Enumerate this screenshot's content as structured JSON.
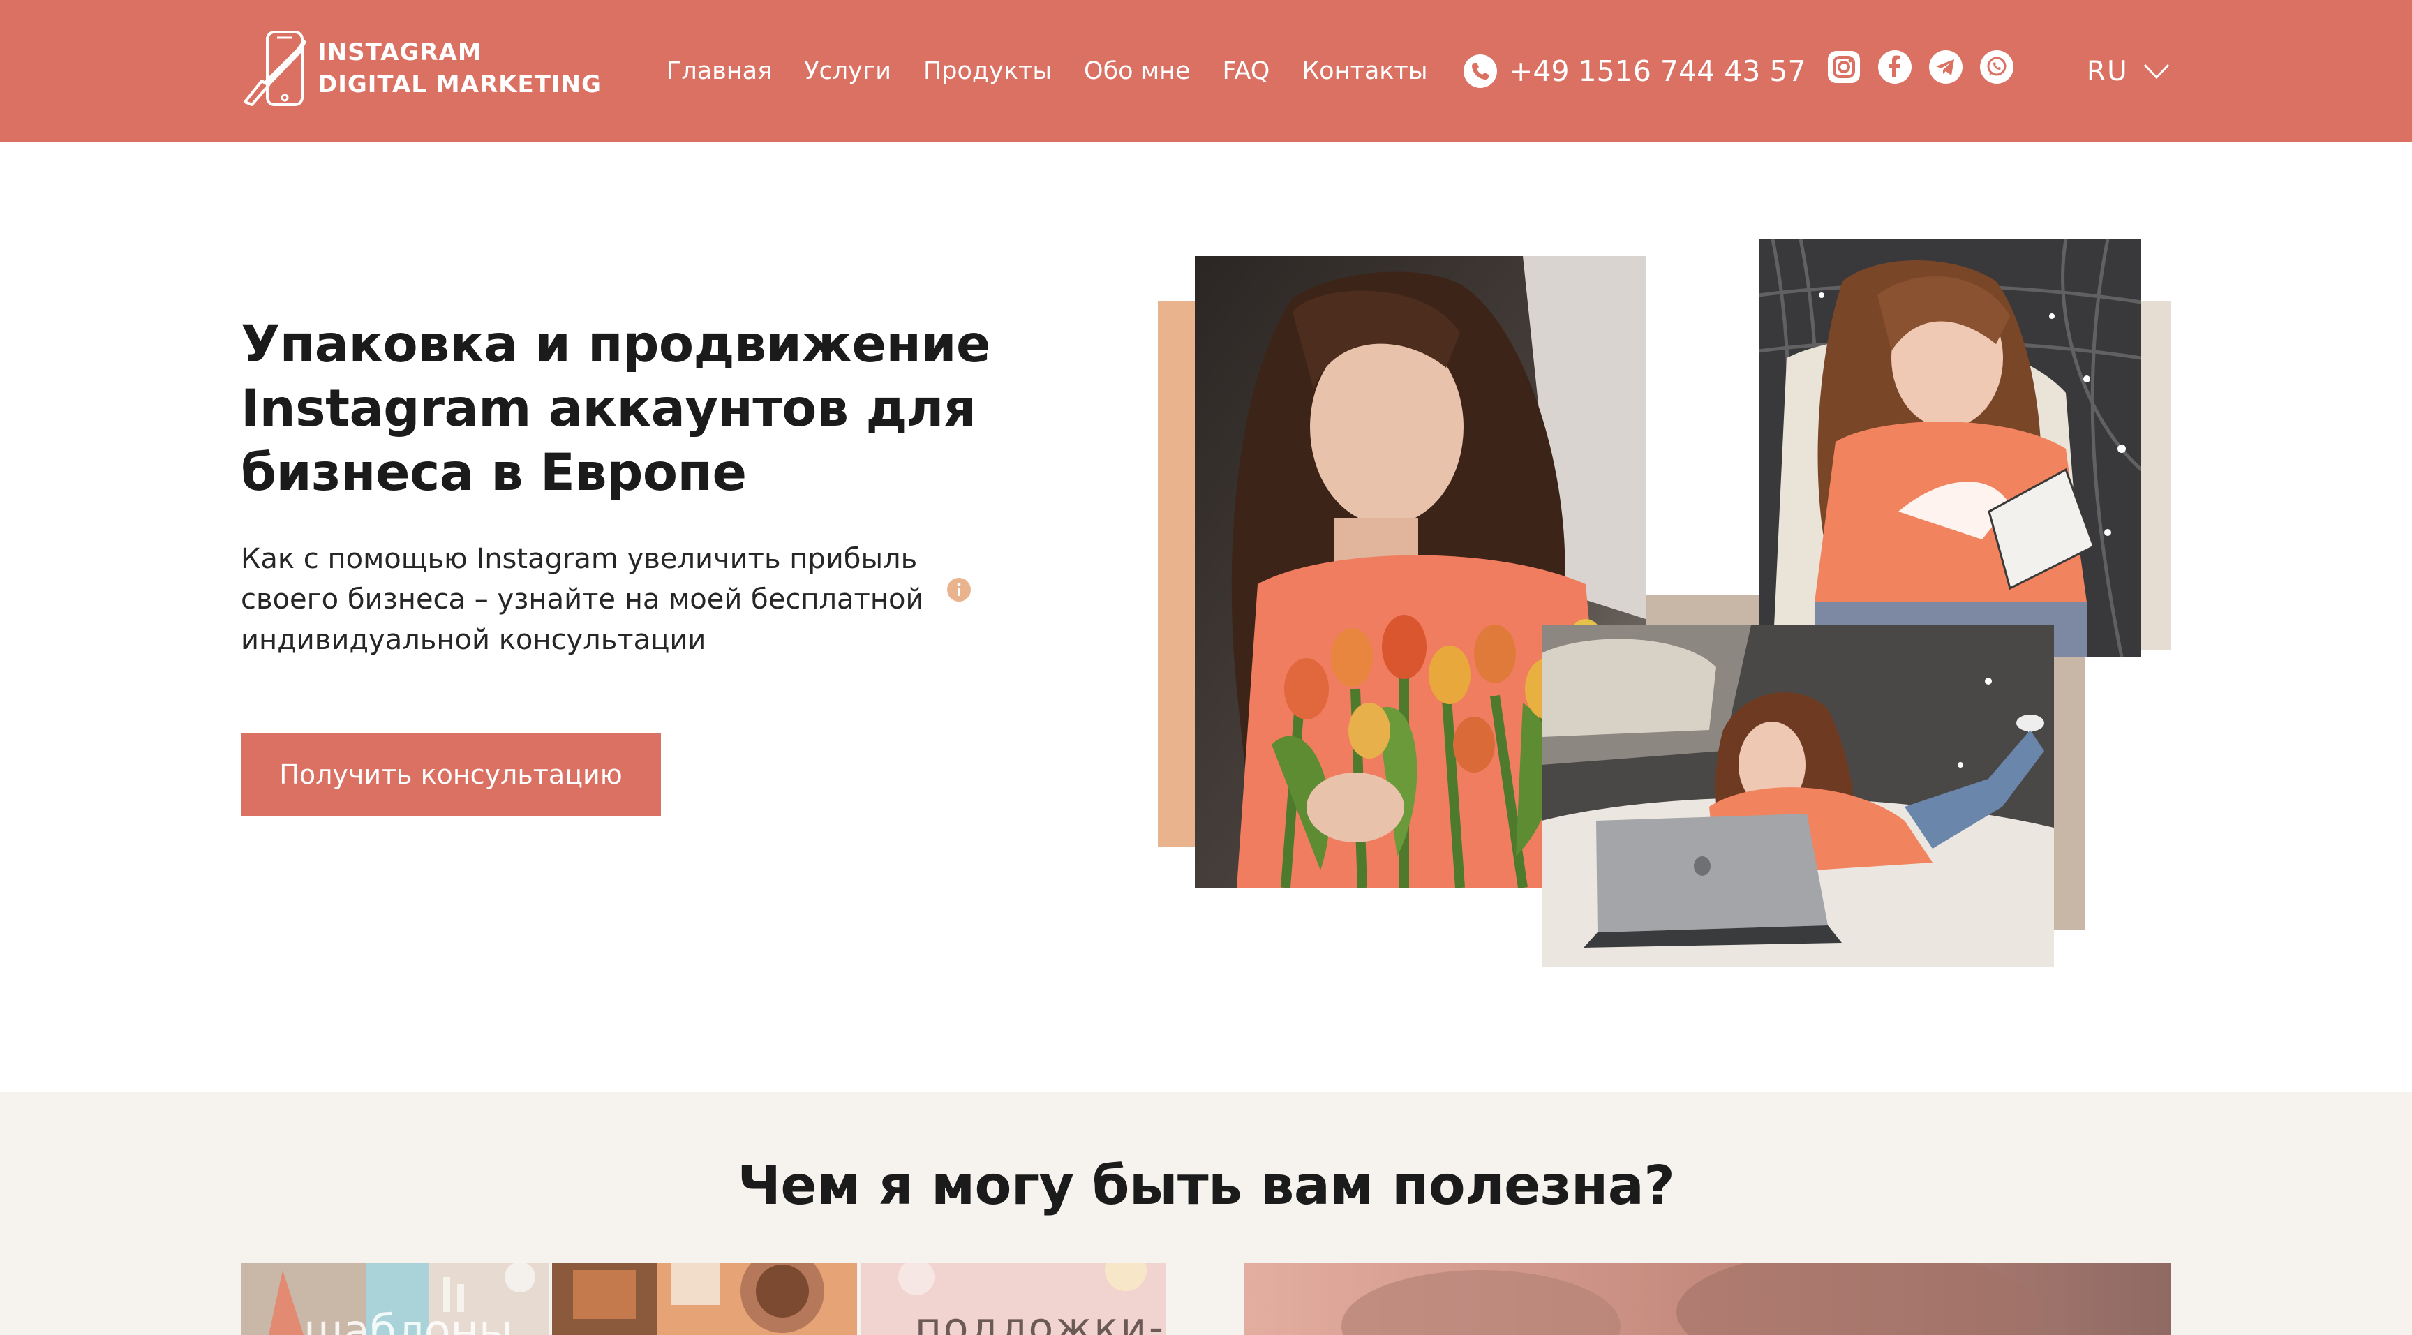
{
  "header": {
    "logo": {
      "line1": "INSTAGRAM",
      "line2": "DIGITAL MARKETING",
      "icon": "phone-brush-logo-icon"
    },
    "nav": [
      {
        "label": "Главная"
      },
      {
        "label": "Услуги"
      },
      {
        "label": "Продукты"
      },
      {
        "label": "Обо мне"
      },
      {
        "label": "FAQ"
      },
      {
        "label": "Контакты"
      }
    ],
    "phone": {
      "icon": "phone-icon",
      "number": "+49 1516 744 43 57"
    },
    "socials": [
      {
        "name": "instagram-icon"
      },
      {
        "name": "facebook-icon"
      },
      {
        "name": "telegram-icon"
      },
      {
        "name": "whatsapp-icon"
      }
    ],
    "language": {
      "current": "RU",
      "icon": "chevron-down-icon"
    }
  },
  "hero": {
    "title": "Упаковка и продвижение Instagram аккаунтов для бизнеса в Европе",
    "subtitle": "Как с помощью Instagram увеличить прибыль своего бизнеса – узнайте на моей бесплатной индивидуальной консультации",
    "info_icon": "info-icon",
    "cta_label": "Получить консультацию"
  },
  "section2": {
    "title": "Чем я могу быть вам полезна?",
    "tiles": [
      {
        "label": "шаблоны"
      },
      {
        "label": ""
      },
      {
        "label": "подложки-"
      }
    ]
  },
  "colors": {
    "accent": "#db7163",
    "header_bg": "#db7163",
    "section_bg": "#f6f3ee",
    "peach_block": "#e8b38d",
    "taupe_block": "#c8b6a6",
    "beige_block": "#e6ddd2",
    "info_icon": "#e8b38d"
  }
}
